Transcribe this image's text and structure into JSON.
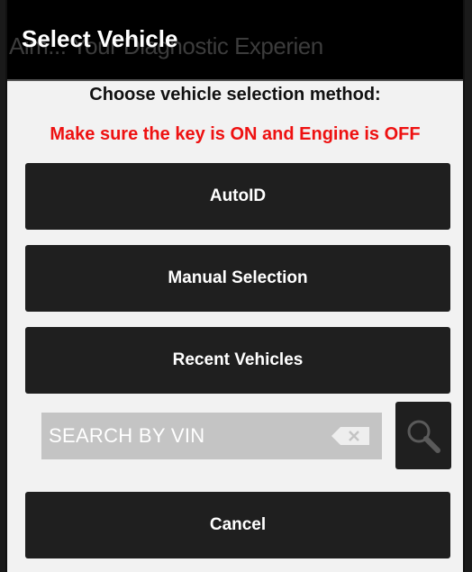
{
  "dialog": {
    "title": "Select Vehicle",
    "background_text": "Aim... Your Diagnostic Experien"
  },
  "prompt": "Choose vehicle selection method:",
  "warning": {
    "text": "Make sure the key is ON and Engine is OFF",
    "color": "#ee1111"
  },
  "buttons": {
    "autoid": "AutoID",
    "manual": "Manual Selection",
    "recent": "Recent Vehicles",
    "cancel": "Cancel"
  },
  "search": {
    "placeholder": "SEARCH BY VIN",
    "clear_icon": "backspace-clear-icon",
    "search_icon": "magnifier-icon"
  }
}
